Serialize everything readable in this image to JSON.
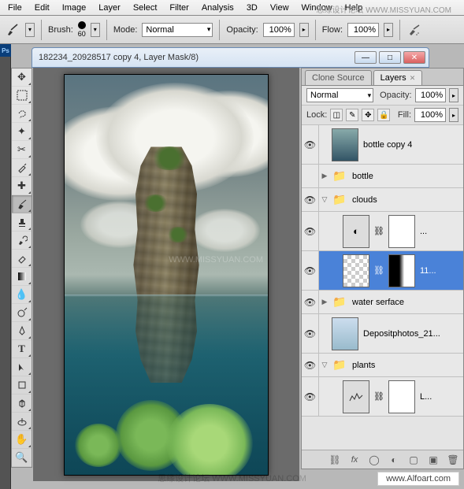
{
  "menu": {
    "items": [
      "File",
      "Edit",
      "Image",
      "Layer",
      "Select",
      "Filter",
      "Analysis",
      "3D",
      "View",
      "Window",
      "Help"
    ]
  },
  "watermark_top": "思缘设计论坛  WWW.MISSYUAN.COM",
  "options": {
    "brush_label": "Brush:",
    "brush_size": "60",
    "mode_label": "Mode:",
    "mode_value": "Normal",
    "opacity_label": "Opacity:",
    "opacity_value": "100%",
    "flow_label": "Flow:",
    "flow_value": "100%"
  },
  "doc": {
    "title": "182234_20928517 copy 4, Layer Mask/8)"
  },
  "ps_badge": "Ps",
  "panel": {
    "tabs": {
      "clone": "Clone Source",
      "layers": "Layers"
    },
    "blend_mode": "Normal",
    "opacity_label": "Opacity:",
    "opacity_value": "100%",
    "lock_label": "Lock:",
    "fill_label": "Fill:",
    "fill_value": "100%"
  },
  "layers": {
    "l0": {
      "name": "bottle copy 4"
    },
    "l1": {
      "name": "bottle"
    },
    "l2": {
      "name": "clouds"
    },
    "l3": {
      "name": "..."
    },
    "l4": {
      "name": "11..."
    },
    "l5": {
      "name": "water serface"
    },
    "l6": {
      "name": "Depositphotos_21..."
    },
    "l7": {
      "name": "plants"
    },
    "l8": {
      "name": "L..."
    }
  },
  "credit": "www.Alfoart.com",
  "wm_bottom": "思缘设计论坛  WWW.MISSYUAN.COM",
  "wm_canvas": "WWW.MISSYUAN.COM"
}
